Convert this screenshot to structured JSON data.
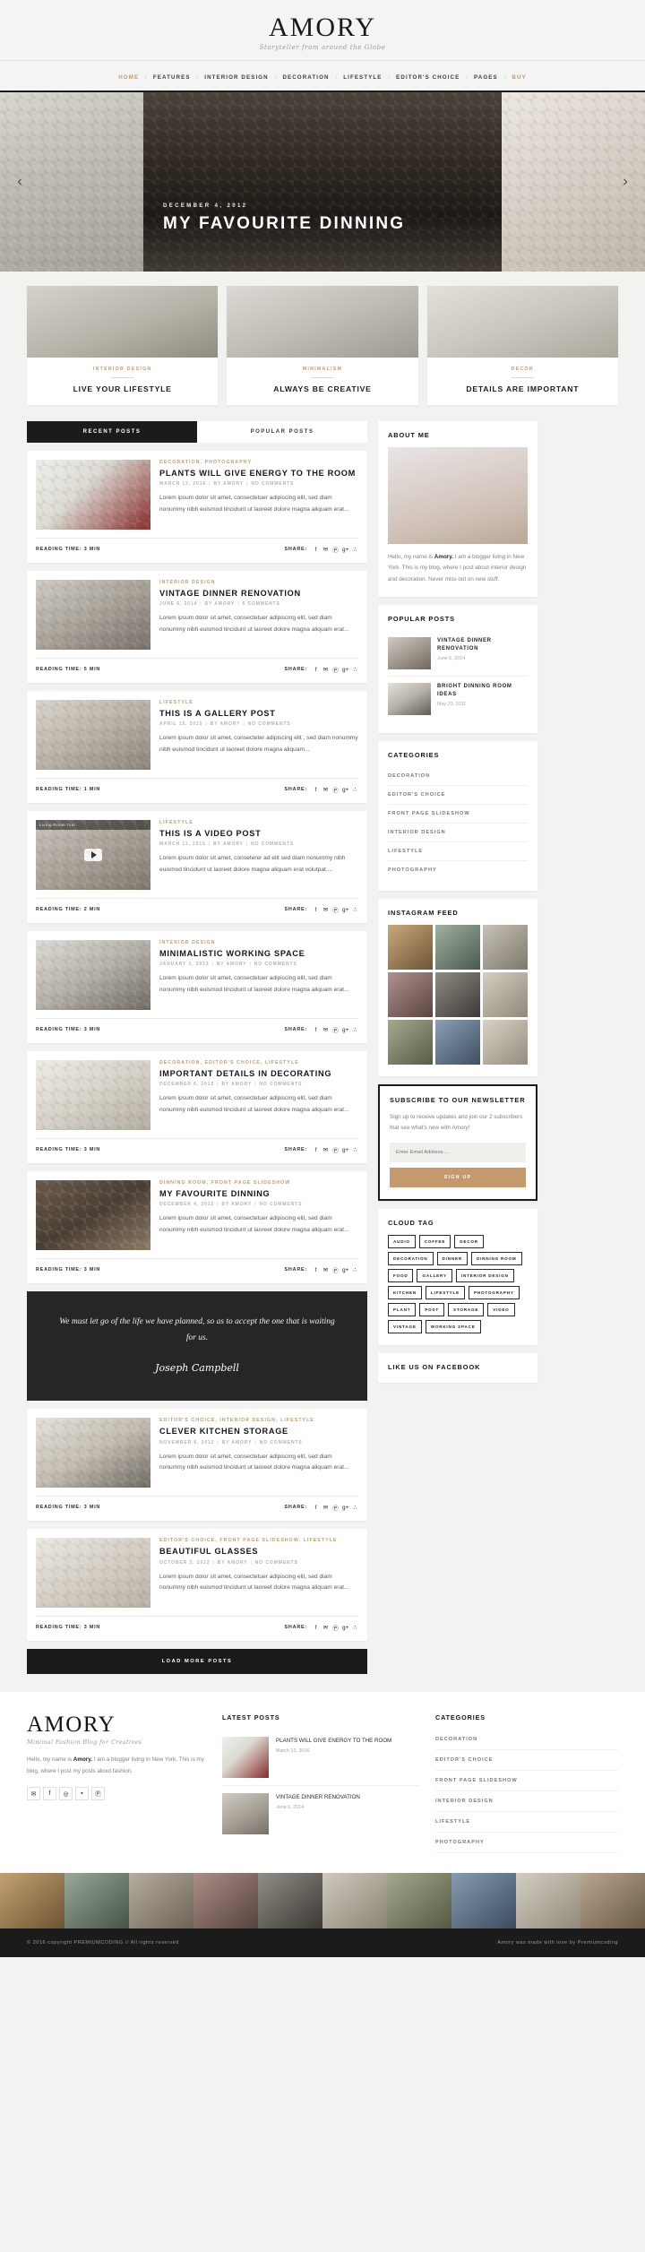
{
  "header": {
    "logo": "AMORY",
    "tagline": "Storyteller from around the Globe",
    "nav": [
      {
        "label": "HOME",
        "accent": true
      },
      {
        "label": "FEATURES",
        "accent": false
      },
      {
        "label": "INTERIOR DESIGN",
        "accent": false
      },
      {
        "label": "DECORATION",
        "accent": false
      },
      {
        "label": "LIFESTYLE",
        "accent": false
      },
      {
        "label": "EDITOR'S CHOICE",
        "accent": false
      },
      {
        "label": "PAGES",
        "accent": false
      },
      {
        "label": "BUY",
        "accent": true
      }
    ]
  },
  "hero": {
    "date": "DECEMBER 4, 2012",
    "title": "MY FAVOURITE DINNING",
    "prev_icon": "chevron-left",
    "next_icon": "chevron-right"
  },
  "features": [
    {
      "category": "INTERIOR DESIGN",
      "title": "LIVE YOUR LIFESTYLE"
    },
    {
      "category": "MINIMALISM",
      "title": "ALWAYS BE CREATIVE"
    },
    {
      "category": "DECOR",
      "title": "DETAILS ARE IMPORTANT"
    }
  ],
  "tabs": [
    {
      "label": "RECENT POSTS",
      "active": true
    },
    {
      "label": "POPULAR POSTS",
      "active": false
    }
  ],
  "share_label": "SHARE:",
  "share_icons": [
    "facebook",
    "twitter",
    "pinterest",
    "google-plus",
    "share-alt"
  ],
  "posts": [
    {
      "category": "DECORATION, PHOTOGRAPHY",
      "title": "PLANTS WILL GIVE ENERGY TO THE ROOM",
      "date": "MARCH 12, 2016",
      "author": "BY AMORY",
      "comments": "NO COMMENTS",
      "excerpt": "Lorem ipsum dolor sit amet, consectetuer adipiscing elit, sed diam nonummy nibh euismod tincidunt ut laoreet dolore magna aliquam erat...",
      "reading_time": "READING TIME: 3 MIN"
    },
    {
      "category": "INTERIOR DESIGN",
      "title": "VINTAGE DINNER RENOVATION",
      "date": "JUNE 6, 2014",
      "author": "BY AMORY",
      "comments": "6 COMMENTS",
      "excerpt": "Lorem ipsum dolor sit amet, consectetuer adipiscing elit, sed diam nonummy nibh euismod tincidunt ut laoreet dolore magna aliquam erat...",
      "reading_time": "READING TIME: 5 MIN"
    },
    {
      "category": "LIFESTYLE",
      "title": "THIS IS A GALLERY POST",
      "date": "APRIL 15, 2015",
      "author": "BY AMORY",
      "comments": "NO COMMENTS",
      "excerpt": "Lorem ipsum dolor sit amet, consecteter adipiscing elit , sed diam nonummy nibh euismod tincidunt ut laoreet dolore magna aliquam...",
      "reading_time": "READING TIME: 1 MIN"
    },
    {
      "category": "LIFESTYLE",
      "title": "THIS IS A VIDEO POST",
      "date": "MARCH 11, 2015",
      "author": "BY AMORY",
      "comments": "NO COMMENTS",
      "excerpt": "Lorem ipsum dolor sit amet, conseterer ad elit sed diam nonummy nibh euismod tincidunt ut laoreet dolore magna aliquam erat volutpat....",
      "reading_time": "READING TIME: 2 MIN",
      "video_label": "Living Room Tour"
    },
    {
      "category": "INTERIOR DESIGN",
      "title": "MINIMALISTIC WORKING SPACE",
      "date": "JANUARY 3, 2013",
      "author": "BY AMORY",
      "comments": "NO COMMENTS",
      "excerpt": "Lorem ipsum dolor sit amet, consectetuer adipiscing elit, sed diam nonummy nibh euismod tincidunt ut laoreet dolore magna aliquam erat...",
      "reading_time": "READING TIME: 3 MIN"
    },
    {
      "category": "DECORATION, EDITOR'S CHOICE, LIFESTYLE",
      "title": "IMPORTANT DETAILS IN DECORATING",
      "date": "DECEMBER 6, 2012",
      "author": "BY AMORY",
      "comments": "NO COMMENTS",
      "excerpt": "Lorem ipsum dolor sit amet, consectetuer adipiscing elit, sed diam nonummy nibh euismod tincidunt ut laoreet dolore magna aliquam erat...",
      "reading_time": "READING TIME: 3 MIN"
    },
    {
      "category": "DINNING ROOM, FRONT PAGE SLIDESHOW",
      "title": "MY FAVOURITE DINNING",
      "date": "DECEMBER 4, 2012",
      "author": "BY AMORY",
      "comments": "NO COMMENTS",
      "excerpt": "Lorem ipsum dolor sit amet, consectetuer adipiscing elit, sed diam nonummy nibh euismod tincidunt ut laoreet dolore magna aliquam erat...",
      "reading_time": "READING TIME: 3 MIN"
    }
  ],
  "quote": {
    "text": "We must let go of the life we have planned, so as to accept the one that is waiting for us.",
    "author": "Joseph Campbell"
  },
  "posts_after_quote": [
    {
      "category": "EDITOR'S CHOICE, INTERIOR DESIGN, LIFESTYLE",
      "title": "CLEVER KITCHEN STORAGE",
      "date": "NOVEMBER 6, 2012",
      "author": "BY AMORY",
      "comments": "NO COMMENTS",
      "excerpt": "Lorem ipsum dolor sit amet, consectetuer adipiscing elit, sed diam nonummy nibh euismod tincidunt ut laoreet dolore magna aliquam erat...",
      "reading_time": "READING TIME: 3 MIN"
    },
    {
      "category": "EDITOR'S CHOICE, FRONT PAGE SLIDESHOW, LIFESTYLE",
      "title": "BEAUTIFUL GLASSES",
      "date": "OCTOBER 3, 2012",
      "author": "BY AMORY",
      "comments": "NO COMMENTS",
      "excerpt": "Lorem ipsum dolor sit amet, consectetuer adipiscing elit, sed diam nonummy nibh euismod tincidunt ut laoreet dolore magna aliquam erat...",
      "reading_time": "READING TIME: 3 MIN"
    }
  ],
  "load_more": "LOAD MORE POSTS",
  "sidebar": {
    "about": {
      "title": "ABOUT ME",
      "text_before": "Hello, my name is ",
      "name": "Amory.",
      "text_after": " I am a blogger living in New York. This is my blog, where I post about interior design and decoration. Never miss out on new stuff."
    },
    "popular": {
      "title": "POPULAR POSTS",
      "items": [
        {
          "title": "VINTAGE DINNER RENOVATION",
          "date": "June 6, 2014"
        },
        {
          "title": "BRIGHT DINNING ROOM IDEAS",
          "date": "May 23, 2011"
        }
      ]
    },
    "categories": {
      "title": "CATEGORIES",
      "items": [
        "DECORATION",
        "EDITOR'S CHOICE",
        "FRONT PAGE SLIDESHOW",
        "INTERIOR DESIGN",
        "LIFESTYLE",
        "PHOTOGRAPHY"
      ]
    },
    "instagram": {
      "title": "INSTAGRAM FEED",
      "cells": 9
    },
    "newsletter": {
      "title": "SUBSCRIBE TO OUR NEWSLETTER",
      "text": "Sign up to receive updates and join our 2 subscribers that see what's new with Amory!",
      "placeholder": "Enter Email Address ...",
      "button": "SIGN UP"
    },
    "cloud_tag": {
      "title": "CLOUD TAG",
      "tags": [
        "AUDIO",
        "COFFEE",
        "DECOR",
        "DECORATION",
        "DINNER",
        "DINNING ROOM",
        "FOOD",
        "GALLERY",
        "INTERIOR DESIGN",
        "KITCHEN",
        "LIFESTYLE",
        "PHOTOGRAPHY",
        "PLANT",
        "POST",
        "STORAGE",
        "VIDEO",
        "VINTAGE",
        "WORKING SPACE"
      ]
    },
    "facebook": {
      "title": "LIKE US ON FACEBOOK"
    }
  },
  "footer": {
    "logo": "AMORY",
    "tagline": "Minimal Fashion Blog for Creatives",
    "about_before": "Hello, my name is ",
    "about_name": "Amory.",
    "about_after": " I am a blogger living in New York. This is my blog, where I post my posts about fashion.",
    "social": [
      "twitter",
      "facebook",
      "instagram",
      "youtube",
      "pinterest"
    ],
    "latest": {
      "title": "LATEST POSTS",
      "items": [
        {
          "title": "PLANTS WILL GIVE ENERGY TO THE ROOM",
          "date": "March 13, 2016"
        },
        {
          "title": "VINTAGE DINNER RENOVATION",
          "date": "June 6, 2014"
        }
      ]
    },
    "categories": {
      "title": "CATEGORIES",
      "items": [
        "DECORATION",
        "EDITOR'S CHOICE",
        "FRONT PAGE SLIDESHOW",
        "INTERIOR DESIGN",
        "LIFESTYLE",
        "PHOTOGRAPHY"
      ]
    },
    "copyright_left": "© 2016 copyright PREMIUMCODING // All rights reserved",
    "copyright_right": "Amory was made with love by Premiumcoding"
  },
  "colors": {
    "accent": "#c49a6c",
    "dark": "#1b1b1b",
    "page_bg": "#f2f2f0"
  }
}
